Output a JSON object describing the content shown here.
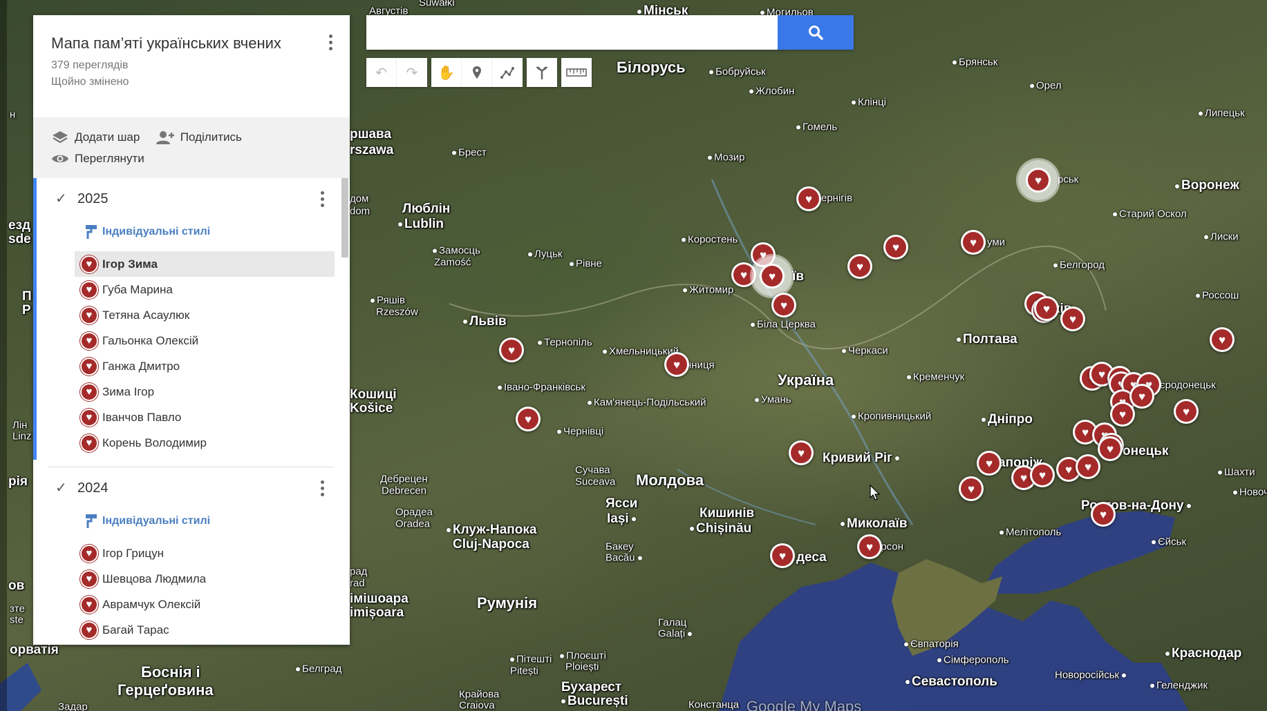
{
  "panel": {
    "title": "Мапа пам’яті українських вчених",
    "views": "379 переглядів",
    "status": "Щойно змінено",
    "actions": {
      "add_layer": "Додати шар",
      "share": "Поділитись",
      "preview": "Переглянути"
    },
    "layers": [
      {
        "name": "2025",
        "style_label": "Індивідуальні стилі",
        "items": [
          "Ігор Зима",
          "Губа Марина",
          "Тетяна Асаулюк",
          "Гальонка Олексій",
          "Ганжа Дмитро",
          "Зима Ігор",
          "Іванчов Павло",
          "Корень Володимир"
        ],
        "selected_item": "Ігор Зима"
      },
      {
        "name": "2024",
        "style_label": "Індивідуальні стилі",
        "items": [
          "Ігор Грицун",
          "Шевцова Людмила",
          "Аврамчук Олексій",
          "Багай Тарас"
        ]
      }
    ]
  },
  "search": {
    "value": "",
    "icon": "search-icon"
  },
  "toolbar": [
    "undo-icon",
    "redo-icon",
    "hand-icon",
    "marker-icon",
    "draw-line-icon",
    "directions-icon",
    "ruler-icon"
  ],
  "map": {
    "countries": {
      "belarus": "Білорусь",
      "ukraine": "Україна",
      "moldova": "Молдова",
      "romania": "Румунія",
      "bosnia_1": "Боснія і",
      "bosnia_2": "Герцеґовина",
      "croatia": "орватія"
    },
    "cities": {
      "minsk": "Мінськ",
      "avgustiv": "Августів",
      "mogyliv": "Могильов",
      "bryansk": "Брянськ",
      "bobruisk": "Бобруйськ",
      "zhlobin": "Жлобин",
      "klintsy": "Клінці",
      "orel": "Орел",
      "gomel": "Гомель",
      "lipetsk": "Липецьк",
      "mozyr": "Мозир",
      "brest": "Брест",
      "varshava_1": "ршава",
      "varshava_2": "rszawa",
      "voronezh": "Воронеж",
      "lublin_1": "Люблін",
      "lublin_2": "Lublin",
      "korosten": "Коростень",
      "stary_oskol": "Старий Оскол",
      "zamosc_1": "Замосць",
      "zamosc_2": "Zamość",
      "lutsk": "Луцьк",
      "rivne": "Рівне",
      "liski": "Лиски",
      "belgorod": "Белгород",
      "zhytomyr": "Житомир",
      "rossosh": "Россош",
      "rzeszow_1": "Ряшів",
      "rzeszow_2": "Rzeszów",
      "lviv": "Львів",
      "bila_tserkva": "Біла Церква",
      "ternopil": "Тернопіль",
      "khmelnytskyi": "Хмельницький",
      "cherkasy": "Черкаси",
      "poltava": "Полтава",
      "ivano_frankivsk": "Івано-Франківськ",
      "kremenchuk": "Кременчук",
      "uman": "Умань",
      "kamianets": "Кам'янець-Подільський",
      "kosice_1": "Кошиці",
      "kosice_2": "Košice",
      "kropyvnytskyi": "Кропивницький",
      "dnipro": "Дніпро",
      "chernivtsi": "Чернівці",
      "kryvyi_rih": "Кривий Ріг",
      "debrecen_1": "Дебрецен",
      "debrecen_2": "Debrecen",
      "suceava_1": "Сучава",
      "suceava_2": "Suceava",
      "shakhty": "Шахти",
      "novocherkassk": "Новочер",
      "oradea_1": "Орадеа",
      "oradea_2": "Oradea",
      "iasi_1": "Ясси",
      "iasi_2": "Iași",
      "kishinev_1": "Кишинів",
      "kishinev_2": "Chișinău",
      "mykolaiv": "Миколаїв",
      "rostov": "Ростов-на-Дону",
      "cluj_1": "Клуж-Напока",
      "cluj_2": "Cluj-Napoca",
      "bacau_1": "Бакеу",
      "bacau_2": "Bacău",
      "melitopol": "Мелітополь",
      "yeisk": "Єйськ",
      "odesa": "деса",
      "kherson": "ерсон",
      "arad_1": "рад",
      "arad_2": "rad",
      "timisoara_1": "імішоара",
      "timisoara_2": "imișoara",
      "galati_1": "Галац",
      "galati_2": "Galați",
      "yevpatoria": "Євпаторія",
      "krasnodar": "Краснодар",
      "simferopol": "Сімферополь",
      "novorossiysk": "Новоросійськ",
      "gelendzhik": "Геленджик",
      "pitesti_1": "Пітешті",
      "pitesti_2": "Pitești",
      "ploiesti_1": "Плоєшті",
      "ploiesti_2": "Ploiești",
      "belgrade": "Белград",
      "sevastopol": "Севастополь",
      "craiova_1": "Крайова",
      "craiova_2": "Craiova",
      "bucharest_1": "Бухарест",
      "bucharest_2": "București",
      "constanta": "Констанца",
      "zadar": "Задар",
      "chernihiv": "ернігів",
      "kyiv": "їв",
      "sumy": "уми",
      "kursk": "рськ",
      "kharkiv": "ків",
      "zaporizhzhia": "апоріж",
      "donetsk": "онецьк",
      "sievierodonetsk": "вєродонецьк",
      "vinnytsia": "нниця",
      "edge_1": "н",
      "edge_2": "езд",
      "edge_3": "sde",
      "edge_4": "П",
      "edge_5": "Р",
      "edge_6": "рія",
      "edge_7": "Лін",
      "edge_8": "Linz",
      "edge_9": "ов",
      "edge_10": "зте",
      "edge_11": "ste",
      "domb_1": "дом",
      "domb_2": "dom",
      "suwalki": "Suwałki"
    },
    "watermark": "Google My Maps",
    "pin_icon": "heart-icon",
    "pin_color": "#a52a2a"
  }
}
